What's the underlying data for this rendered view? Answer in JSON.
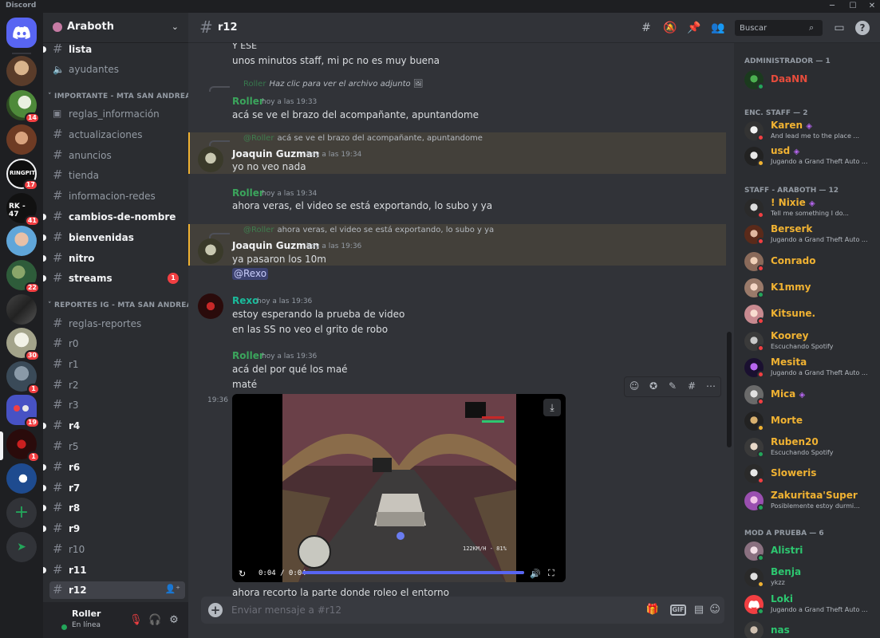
{
  "window": {
    "app_name": "Discord",
    "minimize": "─",
    "maximize": "☐",
    "close": "✕"
  },
  "rail": {
    "servers": [
      {
        "badge": ""
      },
      {
        "badge": "14"
      },
      {
        "badge": ""
      },
      {
        "badge": "17"
      },
      {
        "badge": "41",
        "label": "RK - 47"
      },
      {
        "badge": ""
      },
      {
        "badge": "22"
      },
      {
        "badge": ""
      },
      {
        "badge": "30"
      },
      {
        "badge": "1"
      },
      {
        "badge": "19"
      },
      {
        "badge": "1"
      },
      {
        "badge": ""
      }
    ],
    "add_symbol": "+",
    "explore_symbol": "➤"
  },
  "guild": {
    "name": "Araboth",
    "chevron": "⌄"
  },
  "channels": {
    "top": [
      {
        "name": "lista",
        "unread": true
      },
      {
        "name": "ayudantes",
        "voice": true
      }
    ],
    "cat_importante": "IMPORTANTE - MTA SAN ANDREAS",
    "importante": [
      {
        "name": "reglas_información"
      },
      {
        "name": "actualizaciones"
      },
      {
        "name": "anuncios"
      },
      {
        "name": "tienda"
      },
      {
        "name": "informacion-redes"
      },
      {
        "name": "cambios-de-nombre",
        "unread": true
      },
      {
        "name": "bienvenidas",
        "unread": true
      },
      {
        "name": "nitro",
        "unread": true
      },
      {
        "name": "streams",
        "unread": true,
        "badge": "1"
      }
    ],
    "cat_reportes": "REPORTES IG - MTA SAN ANDREAS",
    "reportes": [
      {
        "name": "reglas-reportes"
      },
      {
        "name": "r0"
      },
      {
        "name": "r1"
      },
      {
        "name": "r2"
      },
      {
        "name": "r3"
      },
      {
        "name": "r4",
        "unread": true
      },
      {
        "name": "r5"
      },
      {
        "name": "r6",
        "unread": true
      },
      {
        "name": "r7",
        "unread": true
      },
      {
        "name": "r8",
        "unread": true
      },
      {
        "name": "r9",
        "unread": true
      },
      {
        "name": "r10"
      },
      {
        "name": "r11",
        "unread": true
      },
      {
        "name": "r12",
        "active": true
      }
    ]
  },
  "user_panel": {
    "name": "Roller",
    "status": "En línea"
  },
  "chat_header": {
    "channel": "r12",
    "search_placeholder": "Buscar"
  },
  "messages": {
    "m0_line1": "Y ESE",
    "m0_line2": "unos minutos staff, mi pc no es muy buena",
    "r1_author": "Roller",
    "r1_text": "Haz clic para ver el archivo adjunto",
    "m1_author": "Roller",
    "m1_time": "hoy a las 19:33",
    "m1_text": "acá se ve el brazo del acompañante, apuntandome",
    "r2_author": "@Roller",
    "r2_text": "acá se ve el brazo del acompañante, apuntandome",
    "m2_author": "Joaquin Guzman",
    "m2_time": "hoy a las 19:34",
    "m2_text": "yo no veo nada",
    "m3_author": "Roller",
    "m3_time": "hoy a las 19:34",
    "m3_text": "ahora veras, el video se está exportando, lo subo y ya",
    "r3_author": "@Roller",
    "r3_text": "ahora veras, el video se está exportando, lo subo y ya",
    "m4_author": "Joaquin Guzman",
    "m4_time": "hoy a las 19:36",
    "m4_text": "ya pasaron los 10m",
    "m4_mention": "@Rexo",
    "m5_author": "Rexo",
    "m5_time": "hoy a las 19:36",
    "m5_line1": "estoy esperando la prueba de video",
    "m5_line2": "en las SS no veo el grito de robo",
    "m6_author": "Roller",
    "m6_time": "hoy a las 19:36",
    "m6_line1": "acá del por qué los maé",
    "m6_line2": "maté",
    "video_side_time": "19:36",
    "video_time": "0:04 / 0:04",
    "video_progress": 1.0,
    "hud_speed": "122KM/H - 81%",
    "m7_text": "ahora recorto la parte donde roleo el entorno"
  },
  "composer": {
    "placeholder": "Enviar mensaje a #r12"
  },
  "members": {
    "cat_admin": "ADMINISTRADOR — 1",
    "cat_enc": "ENC. STAFF — 2",
    "cat_staff": "STAFF - ARABOTH — 12",
    "cat_mod": "MOD A PRUEBA — 6",
    "admin": [
      {
        "name": "DaaNN",
        "activity": ""
      }
    ],
    "enc": [
      {
        "name": "Karen",
        "activity": "And lead me to the place ..."
      },
      {
        "name": "usd",
        "activity": "Jugando a Grand Theft Auto ..."
      }
    ],
    "staff": [
      {
        "name": "! Nixie",
        "activity": "Tell me something I do..."
      },
      {
        "name": "Berserk",
        "activity": "Jugando a Grand Theft Auto ..."
      },
      {
        "name": "Conrado",
        "activity": ""
      },
      {
        "name": "K1mmy",
        "activity": ""
      },
      {
        "name": "Kitsune.",
        "activity": ""
      },
      {
        "name": "Koorey",
        "activity": "Escuchando Spotify"
      },
      {
        "name": "Mesita",
        "activity": "Jugando a Grand Theft Auto ..."
      },
      {
        "name": "Mica",
        "activity": ""
      },
      {
        "name": "Morte",
        "activity": ""
      },
      {
        "name": "Ruben20",
        "activity": "Escuchando Spotify"
      },
      {
        "name": "Sloweris",
        "activity": ""
      },
      {
        "name": "Zakuritaa'Super",
        "activity": "Posiblemente estoy durmi..."
      }
    ],
    "mod": [
      {
        "name": "Alistri",
        "activity": ""
      },
      {
        "name": "Benja",
        "activity": "ykzz"
      },
      {
        "name": "Loki",
        "activity": "Jugando a Grand Theft Auto ..."
      },
      {
        "name": "nas",
        "activity": ""
      }
    ]
  },
  "colors": {
    "accent": "#5865f2",
    "mention_bg": "#43403a",
    "mention_bar": "#f0b232",
    "online": "#23a55a",
    "dnd": "#f23f42",
    "idle": "#f0b232",
    "roller_name": "#3ba55c",
    "joaquin_name": "#f2f3f5",
    "rexo_name": "#1abc9c",
    "admin_name": "#e74c3c",
    "staff_name": "#f0b232",
    "mod_name": "#2dc770"
  }
}
